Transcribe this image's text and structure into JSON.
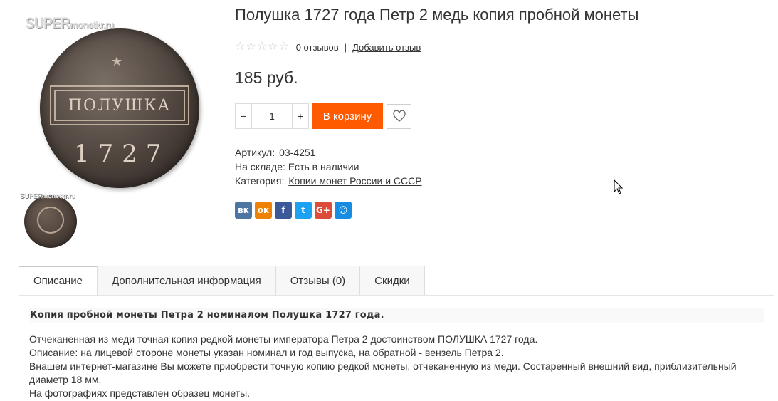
{
  "watermark": {
    "brand": "SUPER",
    "domain": "monetkr.ru"
  },
  "coin_obverse": {
    "denomination": "ПОЛУШКА",
    "year": "1727"
  },
  "product": {
    "title": "Полушка 1727 года Петр 2 медь копия пробной монеты",
    "rating": {
      "stars": 0,
      "max": 5,
      "reviews_text": "0 отзывов",
      "add_review": "Добавить отзыв"
    },
    "price": "185 руб.",
    "quantity": "1",
    "qty_minus": "−",
    "qty_plus": "+",
    "add_to_cart": "В корзину",
    "sku_label": "Артикул:",
    "sku_value": "03-4251",
    "stock_label": "На складе:",
    "stock_value": "Есть в наличии",
    "category_label": "Категория:",
    "category_value": "Копии монет России и СССР"
  },
  "social": [
    {
      "name": "vk",
      "glyph": "вк",
      "color": "#4c75a3"
    },
    {
      "name": "odnoklassniki",
      "glyph": "ок",
      "color": "#ee8208"
    },
    {
      "name": "facebook",
      "glyph": "f",
      "color": "#3b5998"
    },
    {
      "name": "twitter",
      "glyph": "t",
      "color": "#1da1f2"
    },
    {
      "name": "google-plus",
      "glyph": "G+",
      "color": "#dd4b39"
    },
    {
      "name": "moimir",
      "glyph": "☺",
      "color": "#168de2"
    }
  ],
  "tabs": [
    {
      "label": "Описание",
      "active": true
    },
    {
      "label": "Дополнительная информация",
      "active": false
    },
    {
      "label": "Отзывы (0)",
      "active": false
    },
    {
      "label": "Скидки",
      "active": false
    }
  ],
  "description": {
    "heading": "Копия пробной монеты Петра 2 номиналом Полушка 1727 года.",
    "lines": [
      "Отчеканенная из меди точная копия редкой монеты императора Петра 2 достоинством ПОЛУШКА 1727 года.",
      "Описание: на лицевой стороне монеты указан номинал и год выпуска, на обратной - вензель Петра 2.",
      "Внашем интернет-магазине Вы можете приобрести точную копию редкой монеты, отчеканенную из меди. Состаренный внешний вид, приблизительный диаметр 18 мм.",
      "На фотографиях представлен образец монеты."
    ]
  }
}
